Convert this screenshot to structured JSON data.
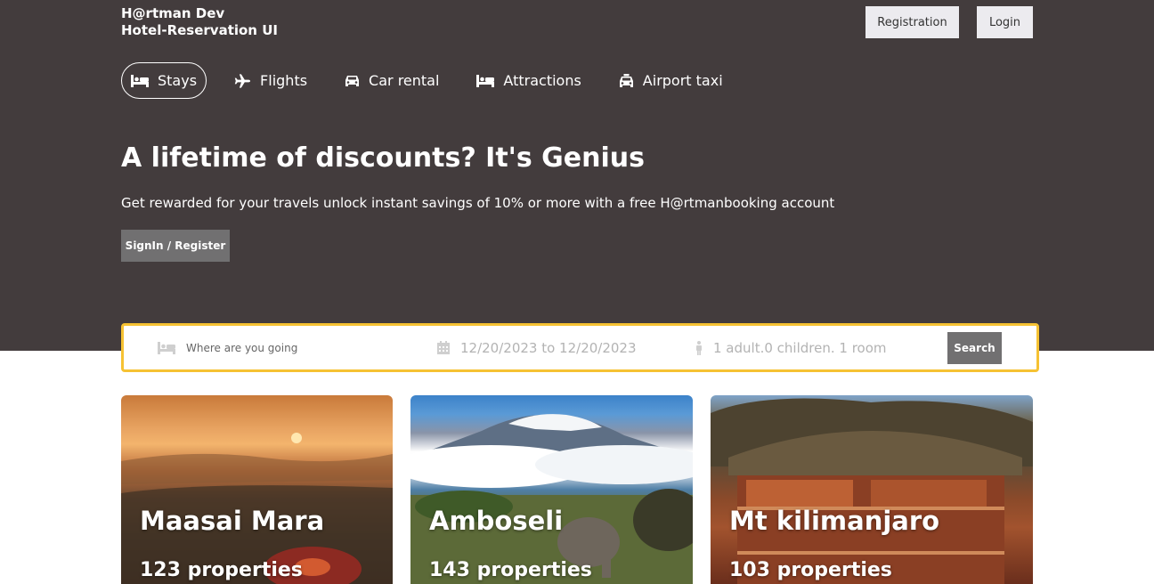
{
  "brand": {
    "line1": "H@rtman Dev",
    "line2": "Hotel-Reservation UI"
  },
  "top_buttons": {
    "registration": "Registration",
    "login": "Login"
  },
  "nav": [
    {
      "label": "Stays",
      "icon": "bed-icon",
      "active": true
    },
    {
      "label": "Flights",
      "icon": "plane-icon",
      "active": false
    },
    {
      "label": "Car rental",
      "icon": "car-icon",
      "active": false
    },
    {
      "label": "Attractions",
      "icon": "bed-icon",
      "active": false
    },
    {
      "label": "Airport taxi",
      "icon": "taxi-icon",
      "active": false
    }
  ],
  "hero": {
    "headline": "A lifetime of discounts? It's Genius",
    "subline": "Get rewarded for your travels unlock instant savings of 10% or more with a free H@rtmanbooking account",
    "cta": "SignIn / Register"
  },
  "search": {
    "destination_placeholder": "Where are you going",
    "dates": "12/20/2023 to 12/20/2023",
    "guests": "1 adult.0 children. 1 room",
    "button": "Search"
  },
  "cards": [
    {
      "title": "Maasai Mara",
      "properties": "123 properties"
    },
    {
      "title": "Amboseli",
      "properties": "143 properties"
    },
    {
      "title": "Mt kilimanjaro",
      "properties": "103 properties"
    }
  ],
  "colors": {
    "header_bg": "#433c3d",
    "search_border": "#f6c233",
    "button_gray": "#717071"
  }
}
